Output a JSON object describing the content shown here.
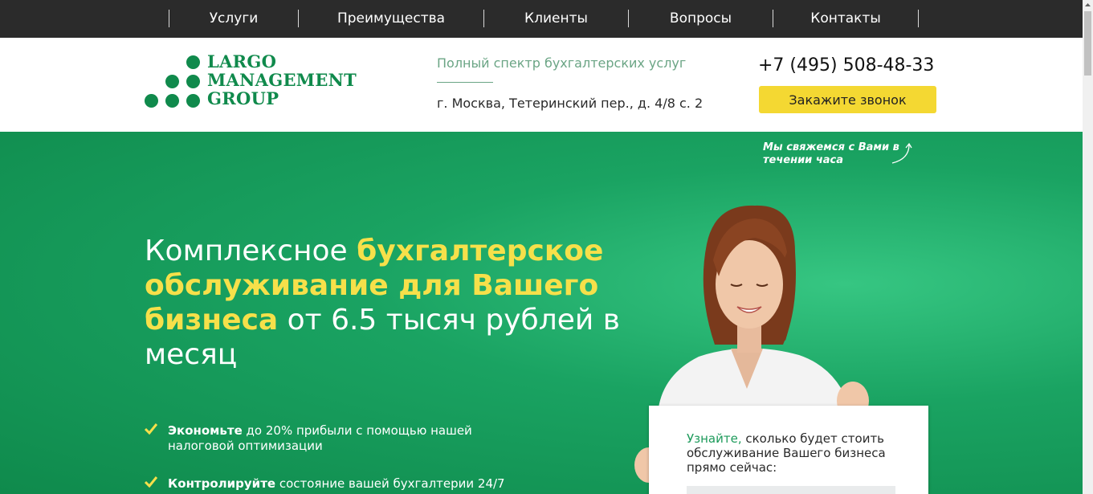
{
  "nav": {
    "items": [
      {
        "label": "Услуги"
      },
      {
        "label": "Преимущества"
      },
      {
        "label": "Клиенты"
      },
      {
        "label": "Вопросы"
      },
      {
        "label": "Контакты"
      }
    ]
  },
  "header": {
    "logo": {
      "line1": "LARGO",
      "line2": "MANAGEMENT",
      "line3": "GROUP"
    },
    "tagline": "Полный спектр бухгалтерских услуг",
    "address": "г. Москва, Тетеринский пер., д. 4/8 с. 2",
    "phone": "+7 (495) 508-48-33",
    "callback_label": "Закажите звонок"
  },
  "hero": {
    "callback_note": "Мы свяжемся с Вами в течении часа",
    "headline": {
      "part1": "Комплексное ",
      "part2": "бухгалтерское обслуживание для Вашего бизнеса",
      "part3": " от 6.5 тысяч рублей в месяц"
    },
    "bullets": [
      {
        "bold": "Экономьте",
        "text": " до 20% прибыли с помощью нашей налоговой оптимизации"
      },
      {
        "bold": "Контролируйте",
        "text": " состояние вашей бухгалтерии 24/7"
      }
    ]
  },
  "card": {
    "highlight": "Узнайте,",
    "text": " сколько будет стоить обслуживание Вашего бизнеса прямо сейчас:"
  },
  "colors": {
    "brand_green": "#108a4c",
    "accent_yellow": "#f4d832",
    "headline_yellow": "#f6e04a",
    "nav_bg": "#2b2b2b"
  },
  "icons": [
    "check-icon",
    "curved-arrow-icon",
    "scroll-up-icon"
  ]
}
